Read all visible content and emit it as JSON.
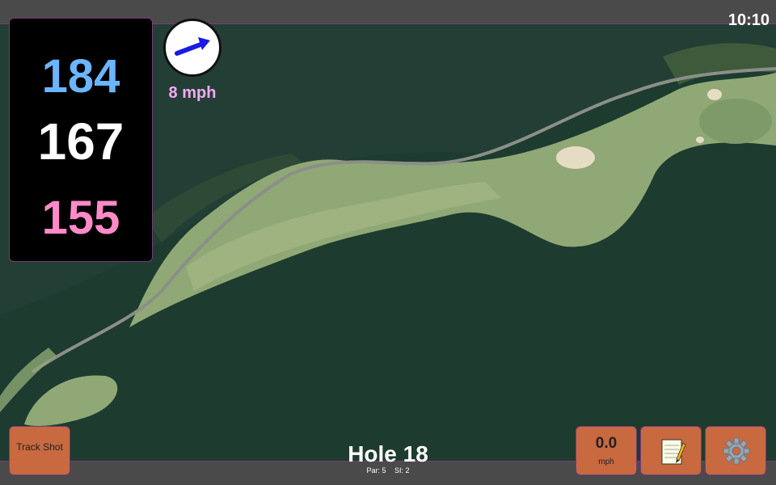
{
  "status": {
    "time": "10:10"
  },
  "distances": {
    "back": {
      "value": "184",
      "color": "#6bb5ff"
    },
    "middle": {
      "value": "167",
      "color": "#ffffff"
    },
    "front": {
      "value": "155",
      "color": "#ff8ac8"
    }
  },
  "wind": {
    "speed": "8 mph",
    "speed_color": "#f5a8f5",
    "icon": "wind-direction-arrow",
    "arrow_color": "#1a1ae6"
  },
  "hole": {
    "title": "Hole 18",
    "par": "Par: 5",
    "si": "SI: 2"
  },
  "buttons": {
    "track_shot": {
      "label": "Track Shot"
    },
    "speed": {
      "value": "0.0",
      "unit": "mph"
    },
    "notes": {
      "icon": "notepad-icon"
    },
    "settings": {
      "icon": "gear-icon"
    }
  },
  "colors": {
    "button_bg": "#c8693f",
    "water": "#1c3a2c",
    "fairway": "#8fa875",
    "bar_border": "#7a3a7a"
  }
}
